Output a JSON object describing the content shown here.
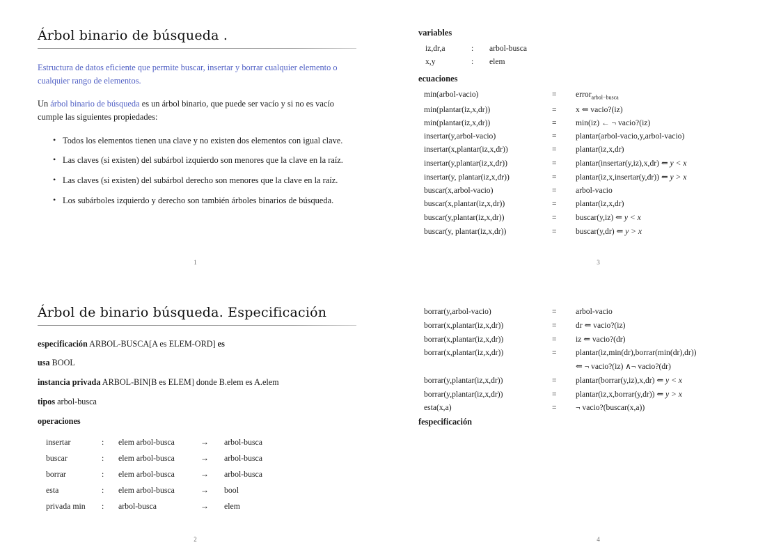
{
  "slides": [
    {
      "id": "slide-1",
      "page_number": "1",
      "title": "Árbol binario de búsqueda .",
      "intro_blue": "Estructura de datos eficiente que permite buscar, insertar y borrar cualquier elemento o cualquier rango de elementos.",
      "definition": {
        "before": "Un ",
        "highlight": "árbol binario de búsqueda",
        "after": " es un árbol binario, que puede ser vacío y si no es vacío cumple las siguientes propiedades:"
      },
      "properties": [
        "Todos los elementos tienen una clave y no existen dos elementos con igual clave.",
        "Las claves (si existen) del subárbol izquierdo son menores que la clave en la raíz.",
        "Las claves (si existen) del subárbol derecho son menores que la clave en la raíz.",
        "Los subárboles izquierdo y derecho son también árboles binarios de búsqueda."
      ]
    },
    {
      "id": "slide-2",
      "page_number": "2",
      "title": "Árbol de binario búsqueda. Especificación",
      "spec_lines": [
        {
          "kw": "especificación",
          "rest": " ARBOL-BUSCA[A es ELEM-ORD] ",
          "kw2": "es"
        },
        {
          "kw": "usa",
          "rest": " BOOL",
          "kw2": ""
        },
        {
          "kw": "instancia privada",
          "rest": " ARBOL-BIN[B es ELEM] donde B.elem es A.elem",
          "kw2": ""
        },
        {
          "kw": "tipos",
          "rest": " arbol-busca",
          "kw2": ""
        }
      ],
      "operations_label": "operaciones",
      "operations": [
        {
          "name": "insertar",
          "colon": ":",
          "domain": "elem arbol-busca",
          "arrow": "→",
          "range": "arbol-busca"
        },
        {
          "name": "buscar",
          "colon": ":",
          "domain": "elem arbol-busca",
          "arrow": "→",
          "range": "arbol-busca"
        },
        {
          "name": "borrar",
          "colon": ":",
          "domain": "elem arbol-busca",
          "arrow": "→",
          "range": "arbol-busca"
        },
        {
          "name": "esta",
          "colon": ":",
          "domain": "elem arbol-busca",
          "arrow": "→",
          "range": "bool"
        },
        {
          "name": "privada min",
          "colon": ":",
          "domain": "arbol-busca",
          "arrow": "→",
          "range": "elem"
        }
      ]
    },
    {
      "id": "slide-3",
      "page_number": "3",
      "variables_label": "variables",
      "variables": [
        {
          "names": "iz,dr,a",
          "colon": ":",
          "type": "arbol-busca"
        },
        {
          "names": "x,y",
          "colon": ":",
          "type": "elem"
        }
      ],
      "equations_label": "ecuaciones",
      "equations": [
        {
          "lhs": "min(arbol-vacio)",
          "eq": "=",
          "rhs": "error",
          "rhs_sub": "arbol−busca"
        },
        {
          "lhs": "min(plantar(iz,x,dr))",
          "eq": "=",
          "rhs": "x ⇐ vacio?(iz)"
        },
        {
          "lhs": "min(plantar(iz,x,dr))",
          "eq": "=",
          "rhs": "min(iz) ← ¬ vacio?(iz)"
        },
        {
          "lhs": "insertar(y,arbol-vacio)",
          "eq": "=",
          "rhs": "plantar(arbol-vacio,y,arbol-vacio)"
        },
        {
          "lhs": "insertar(x,plantar(iz,x,dr))",
          "eq": "=",
          "rhs": "plantar(iz,x,dr)"
        },
        {
          "lhs": "insertar(y,plantar(iz,x,dr))",
          "eq": "=",
          "rhs": "plantar(insertar(y,iz),x,dr) ⇐ ",
          "rhs_math": "y < x"
        },
        {
          "lhs": "insertar(y, plantar(iz,x,dr))",
          "eq": "=",
          "rhs": "plantar(iz,x,insertar(y,dr)) ⇐ ",
          "rhs_math": "y > x"
        },
        {
          "lhs": "buscar(x,arbol-vacio)",
          "eq": "=",
          "rhs": "arbol-vacio"
        },
        {
          "lhs": "buscar(x,plantar(iz,x,dr))",
          "eq": "=",
          "rhs": "plantar(iz,x,dr)"
        },
        {
          "lhs": "buscar(y,plantar(iz,x,dr))",
          "eq": "=",
          "rhs": "buscar(y,iz) ⇐ ",
          "rhs_math": "y < x"
        },
        {
          "lhs": "buscar(y, plantar(iz,x,dr))",
          "eq": "=",
          "rhs": "buscar(y,dr) ⇐ ",
          "rhs_math": "y > x"
        }
      ]
    },
    {
      "id": "slide-4",
      "page_number": "4",
      "equations": [
        {
          "lhs": "borrar(y,arbol-vacio)",
          "eq": "=",
          "rhs": "arbol-vacio"
        },
        {
          "lhs": "borrar(x,plantar(iz,x,dr))",
          "eq": "=",
          "rhs": "dr ⇐ vacio?(iz)"
        },
        {
          "lhs": "borrar(x,plantar(iz,x,dr))",
          "eq": "=",
          "rhs": "iz ⇐ vacio?(dr)"
        },
        {
          "lhs": "borrar(x,plantar(iz,x,dr))",
          "eq": "=",
          "rhs": "plantar(iz,min(dr),borrar(min(dr),dr))",
          "cont": "⇐ ¬ vacio?(iz) ∧¬ vacio?(dr)"
        },
        {
          "lhs": "borrar(y,plantar(iz,x,dr))",
          "eq": "=",
          "rhs": "plantar(borrar(y,iz),x,dr) ⇐ ",
          "rhs_math": "y < x"
        },
        {
          "lhs": "borrar(y,plantar(iz,x,dr))",
          "eq": "=",
          "rhs": "plantar(iz,x,borrar(y,dr)) ⇐ ",
          "rhs_math": "y > x"
        },
        {
          "lhs": "esta(x,a)",
          "eq": "=",
          "rhs": "¬ vacio?(buscar(x,a))"
        }
      ],
      "end_label": "fespecificación"
    }
  ],
  "colors": {
    "accent_blue": "#4f5fc4",
    "text": "#1a1a1a",
    "rule": "#8a8a8a"
  }
}
